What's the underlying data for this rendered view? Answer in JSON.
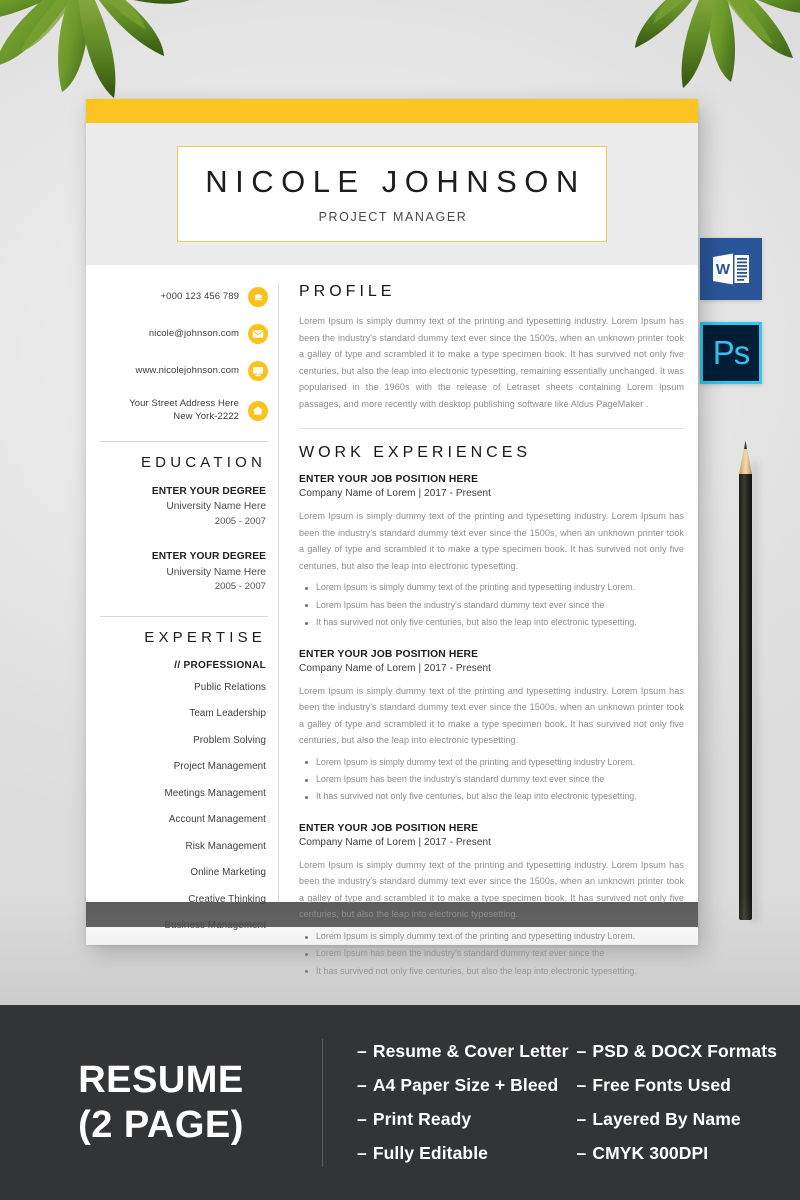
{
  "theme": {
    "accent_yellow": "#FBC421",
    "icon_yellow": "#FCC21B",
    "banner_dark": "#333436",
    "footer_gray": "#5A5A5A",
    "header_gray": "#ECECEC",
    "word_blue": "#2A5699",
    "ps_dark": "#001E36",
    "ps_cyan": "#31C5F0"
  },
  "resume": {
    "header": {
      "name": "NICOLE JOHNSON",
      "role": "PROJECT MANAGER"
    },
    "contacts": [
      {
        "icon": "phone-icon",
        "line1": "+000 123 456 789",
        "line2": ""
      },
      {
        "icon": "email-icon",
        "line1": "nicole@johnson.com",
        "line2": ""
      },
      {
        "icon": "website-icon",
        "line1": "www.nicolejohnson.com",
        "line2": ""
      },
      {
        "icon": "home-icon",
        "line1": "Your Street Address Here",
        "line2": "New York-2222"
      }
    ],
    "education": {
      "heading": "EDUCATION",
      "items": [
        {
          "degree": "ENTER YOUR DEGREE",
          "university": "University Name Here",
          "years": "2005 - 2007"
        },
        {
          "degree": "ENTER YOUR DEGREE",
          "university": "University Name Here",
          "years": "2005 - 2007"
        }
      ]
    },
    "expertise": {
      "heading": "EXPERTISE",
      "subheading": "// PROFESSIONAL",
      "skills": [
        "Public Relations",
        "Team Leadership",
        "Problem Solving",
        "Project Management",
        "Meetings Management",
        "Account Management",
        "Risk Management",
        "Online Marketing",
        "Creative Thinking",
        "Business Management"
      ]
    },
    "profile": {
      "heading": "PROFILE",
      "text": "Lorem Ipsum is simply dummy text of the printing and typesetting industry. Lorem Ipsum has been the industry's standard dummy text ever since the 1500s, when an unknown printer took a galley of type and scrambled it to make a type specimen book. It has survived not only five centuries, but also the leap into electronic typesetting, remaining essentially unchanged. It was popularised in the 1960s with the release of Letraset sheets containing Lorem Ipsum passages, and more recently with desktop publishing software like Aldus PageMaker ."
    },
    "work": {
      "heading": "WORK EXPERIENCES",
      "jobs": [
        {
          "title": "ENTER YOUR JOB POSITION HERE",
          "company": "Company Name of Lorem | 2017 - Present",
          "text": "Lorem Ipsum is simply dummy text of the printing and typesetting industry. Lorem Ipsum has been the industry's standard dummy text ever since the 1500s, when an unknown printer took a galley of type and scrambled it to make a type specimen book. It has survived not only five centuries, but also the leap into electronic typesetting.",
          "bullets": [
            "Lorem Ipsum is simply dummy text of the printing and typesetting industry Lorem.",
            "Lorem Ipsum has been the industry's standard dummy text ever since the",
            "It has survived not only five centuries, but also the leap into electronic typesetting."
          ]
        },
        {
          "title": "ENTER YOUR JOB POSITION HERE",
          "company": "Company Name of Lorem | 2017 - Present",
          "text": "Lorem Ipsum is simply dummy text of the printing and typesetting industry. Lorem Ipsum has been the industry's standard dummy text ever since the 1500s, when an unknown printer took a galley of type and scrambled it to make a type specimen book. It has survived not only five centuries, but also the leap into electronic typesetting.",
          "bullets": [
            "Lorem Ipsum is simply dummy text of the printing and typesetting industry Lorem.",
            "Lorem Ipsum has been the industry's standard dummy text ever since the",
            "It has survived not only five centuries, but also the leap into electronic typesetting."
          ]
        },
        {
          "title": "ENTER YOUR JOB POSITION HERE",
          "company": "Company Name of Lorem | 2017 - Present",
          "text": "Lorem Ipsum is simply dummy text of the printing and typesetting industry. Lorem Ipsum has been the industry's standard dummy text ever since the 1500s, when an unknown printer took a galley of type and scrambled it to make a type specimen book. It has survived not only five centuries, but also the leap into electronic typesetting.",
          "bullets": [
            "Lorem Ipsum is simply dummy text of the printing and typesetting industry Lorem.",
            "Lorem Ipsum has been the industry's standard dummy text ever since the",
            "It has survived not only five centuries, but also the leap into electronic typesetting."
          ]
        }
      ]
    }
  },
  "badges": [
    {
      "icon": "word-icon",
      "label": "W"
    },
    {
      "icon": "photoshop-icon",
      "label": "Ps"
    }
  ],
  "banner": {
    "title_line1": "RESUME",
    "title_line2": "(2 PAGE)",
    "dash": "–",
    "features": [
      "Resume & Cover Letter",
      "PSD & DOCX Formats",
      "A4 Paper Size + Bleed",
      "Free Fonts Used",
      "Print Ready",
      "Layered By Name",
      "Fully Editable",
      "CMYK 300DPI"
    ]
  }
}
